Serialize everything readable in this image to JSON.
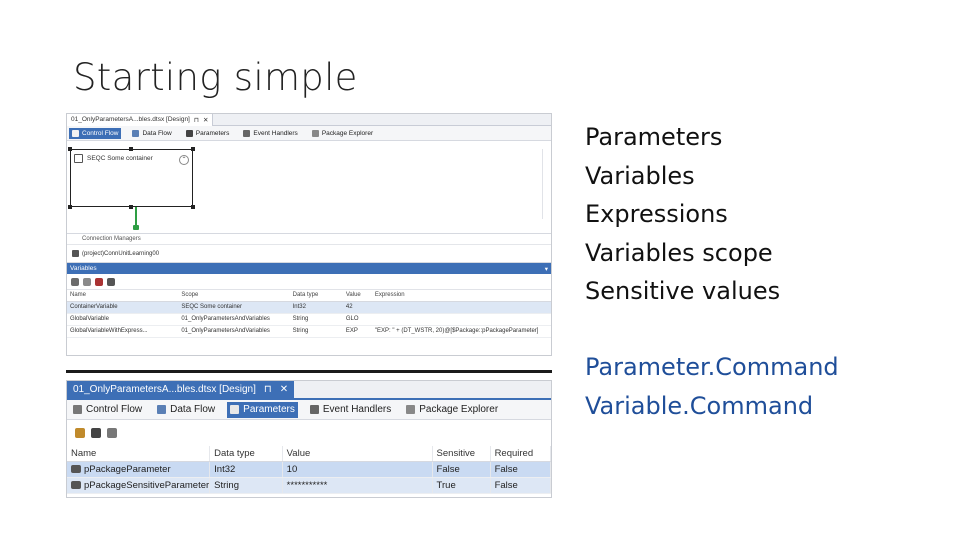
{
  "slide": {
    "title": "Starting simple",
    "bullets": [
      "Parameters",
      "Variables",
      "Expressions",
      "Variables scope",
      "Sensitive values"
    ],
    "bullets2": [
      "Parameter.Command",
      "Variable.Command"
    ]
  },
  "shot1": {
    "doc_tab": "01_OnlyParametersA...bles.dtsx [Design]",
    "pin": "⊓",
    "close": "✕",
    "tabs": [
      "Control Flow",
      "Data Flow",
      "Parameters",
      "Event Handlers",
      "Package Explorer"
    ],
    "container_label": "SEQC Some container",
    "conn_header": "Connection Managers",
    "conn_item": "(project)ConnUnitLearning00",
    "vars_title": "Variables",
    "columns": [
      "Name",
      "Scope",
      "Data type",
      "Value",
      "Expression"
    ],
    "rows": [
      [
        "ContainerVariable",
        "SEQC Some container",
        "Int32",
        "42",
        ""
      ],
      [
        "GlobalVariable",
        "01_OnlyParametersAndVariables",
        "String",
        "GLO",
        ""
      ],
      [
        "GlobalVariableWithExpress...",
        "01_OnlyParametersAndVariables",
        "String",
        "EXP",
        "\"EXP: \" + (DT_WSTR, 20)@[$Package::pPackageParameter]"
      ]
    ]
  },
  "shot2": {
    "doc_tab": "01_OnlyParametersA...bles.dtsx [Design]",
    "pin": "⊓",
    "close": "✕",
    "tabs": [
      "Control Flow",
      "Data Flow",
      "Parameters",
      "Event Handlers",
      "Package Explorer"
    ],
    "columns": [
      "Name",
      "Data type",
      "Value",
      "Sensitive",
      "Required"
    ],
    "rows": [
      [
        "pPackageParameter",
        "Int32",
        "10",
        "False",
        "False"
      ],
      [
        "pPackageSensitiveParameter",
        "String",
        "***********",
        "True",
        "False"
      ]
    ]
  },
  "colors": {
    "accent": "#3d6fb6",
    "link_text": "#1f4e99",
    "connector": "#2e9e44"
  }
}
